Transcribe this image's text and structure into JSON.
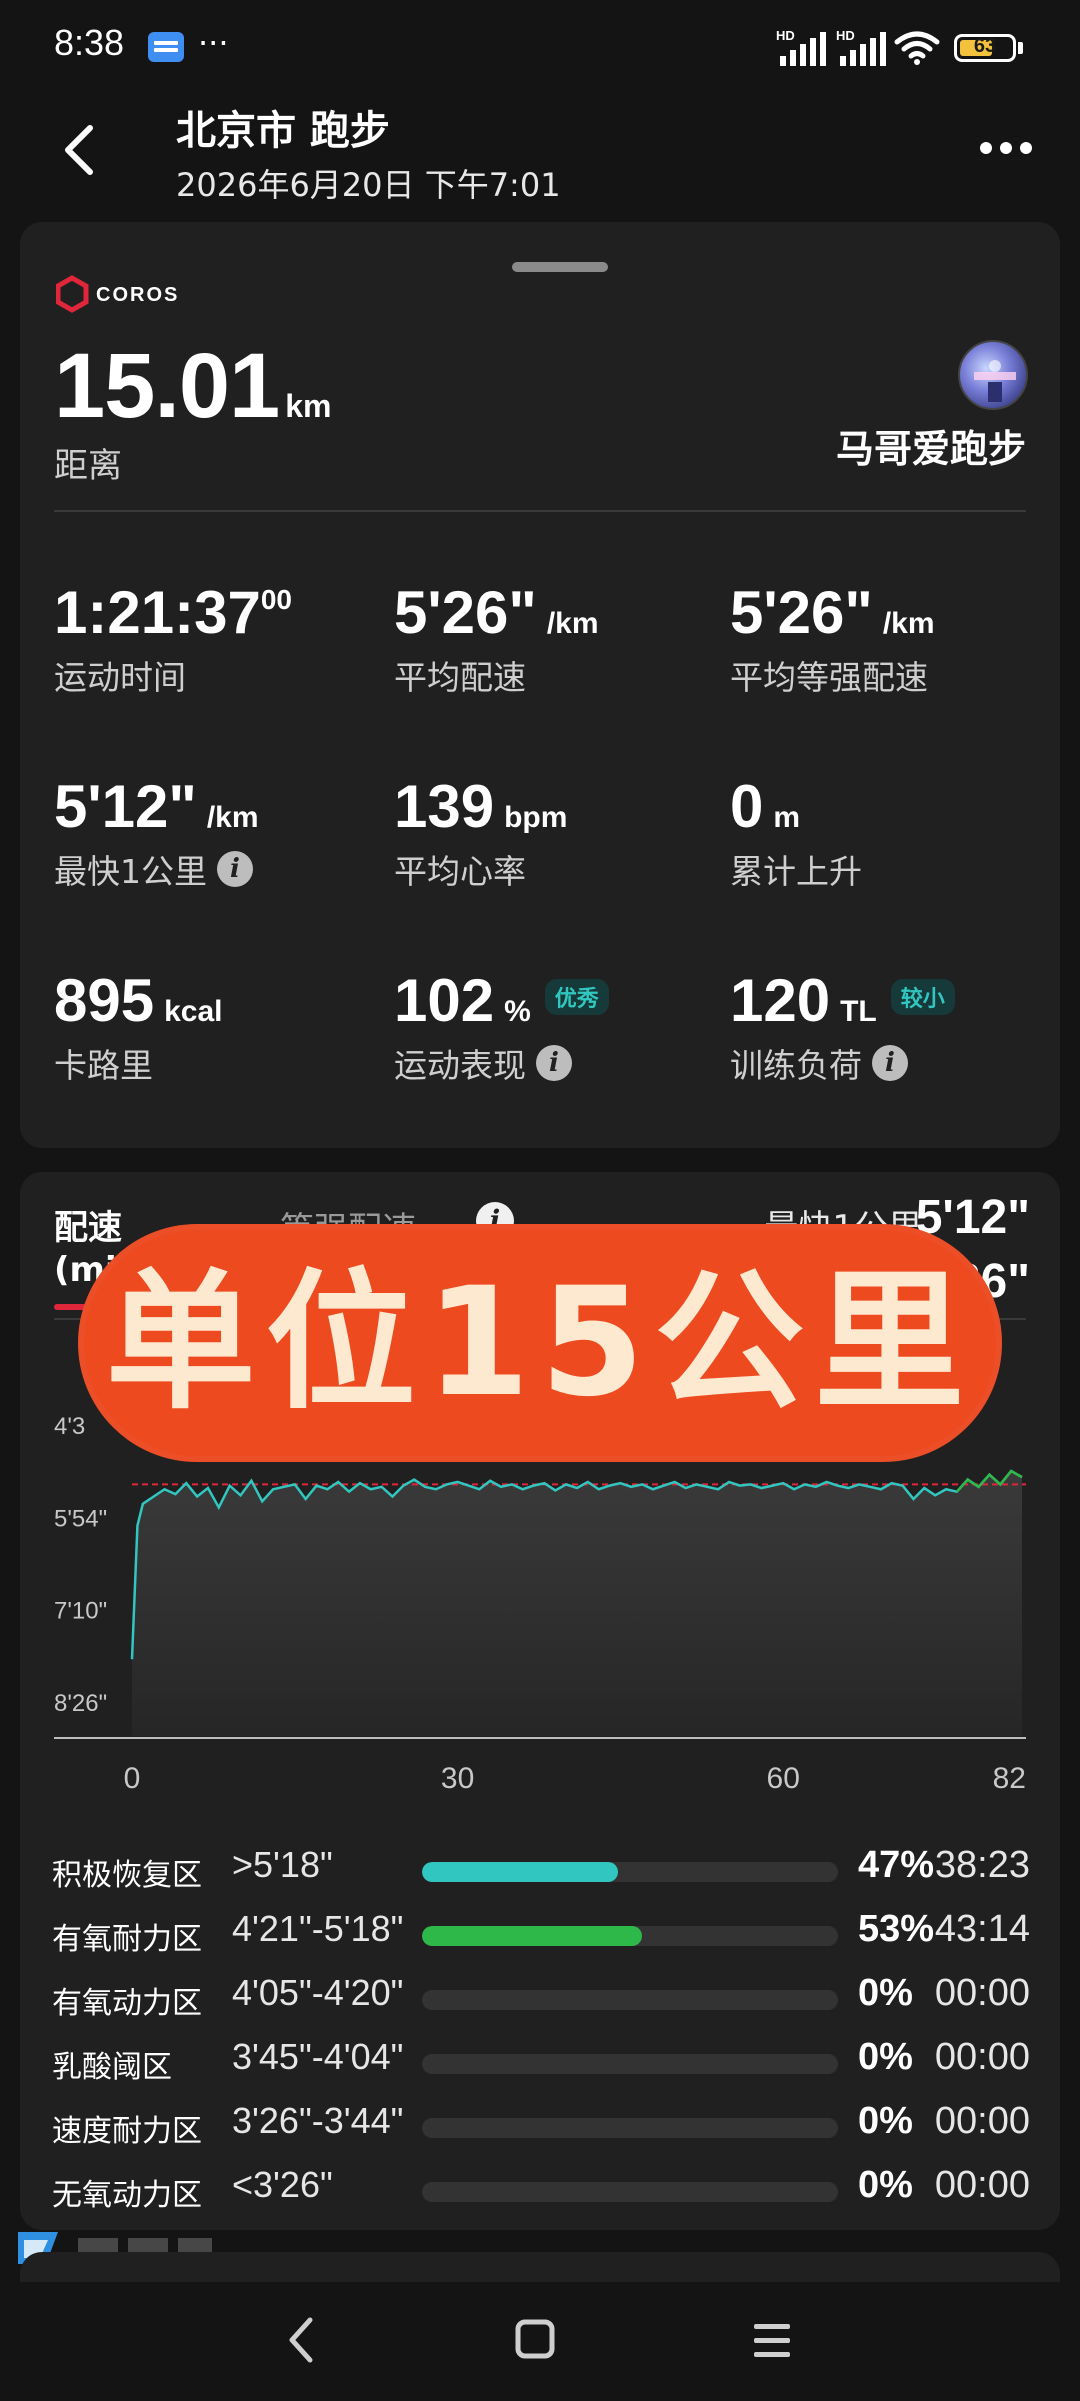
{
  "status_bar": {
    "time": "8:38",
    "notification_icon": "mail-app-icon",
    "more_indicator": "···",
    "signal_1_label": "HD",
    "signal_2_label": "HD",
    "battery_level": "63",
    "battery_percent": 63
  },
  "header": {
    "title": "北京市 跑步",
    "subtitle": "2026年6月20日 下午7:01",
    "back_icon": "chevron-left-icon",
    "more_icon": "more-horizontal-icon"
  },
  "summary": {
    "brand": "COROS",
    "distance_value": "15.01",
    "distance_unit": "km",
    "distance_label": "距离",
    "username": "马哥爱跑步",
    "stats": [
      {
        "value": "1:21:37",
        "sup": "00",
        "unit": "",
        "label": "运动时间"
      },
      {
        "value": "5'26\"",
        "unit": "/km",
        "label": "平均配速"
      },
      {
        "value": "5'26\"",
        "unit": "/km",
        "label": "平均等强配速"
      },
      {
        "value": "5'12\"",
        "unit": "/km",
        "label": "最快1公里"
      },
      {
        "value": "139",
        "unit": "bpm",
        "label": "平均心率"
      },
      {
        "value": "0",
        "unit": "m",
        "label": "累计上升"
      },
      {
        "value": "895",
        "unit": "kcal",
        "label": "卡路里"
      },
      {
        "value": "102",
        "unit": "%",
        "badge": "优秀",
        "label": "运动表现"
      },
      {
        "value": "120",
        "unit": "TL",
        "badge": "较小",
        "label": "训练负荷"
      }
    ]
  },
  "pace_card": {
    "tab_pace": "配速",
    "tab_pace_unit": "(mi",
    "tab_equiv": "等强配速",
    "fastest_label": "最快1公里",
    "fastest_value": "5'12\"",
    "avg_value_partial": "26\"",
    "overlay_text": "单位15公里",
    "chart_data": {
      "type": "line",
      "y_ticks": [
        "4'3",
        "5'54\"",
        "7'10\"",
        "8'26\""
      ],
      "y_tick_values": [
        278,
        354,
        430,
        506
      ],
      "x_ticks": [
        "0",
        "30",
        "60",
        "82"
      ],
      "x_tick_values": [
        0,
        30,
        60,
        82
      ],
      "x_range": [
        0,
        82
      ],
      "y_range_sec_per_km": [
        240,
        530
      ],
      "avg_pace_sec": 326,
      "series_color": "#31c7c0",
      "fast_segment_color": "#2fb84a",
      "avg_line_color": "#e0263a",
      "x": [
        0,
        0.5,
        1,
        2,
        3,
        4,
        5,
        6,
        7,
        8,
        9,
        10,
        11,
        12,
        13,
        14,
        15,
        16,
        17,
        18,
        19,
        20,
        21,
        22,
        23,
        24,
        25,
        26,
        27,
        28,
        29,
        30,
        31,
        32,
        33,
        34,
        35,
        36,
        37,
        38,
        39,
        40,
        41,
        42,
        43,
        44,
        45,
        46,
        47,
        48,
        49,
        50,
        51,
        52,
        53,
        54,
        55,
        56,
        57,
        58,
        59,
        60,
        61,
        62,
        63,
        64,
        65,
        66,
        67,
        68,
        69,
        70,
        71,
        72,
        73,
        74,
        75,
        76,
        77,
        78,
        79,
        80,
        81,
        82
      ],
      "y": [
        470,
        360,
        342,
        336,
        330,
        334,
        325,
        336,
        329,
        345,
        327,
        335,
        323,
        340,
        330,
        328,
        326,
        338,
        327,
        330,
        324,
        332,
        325,
        330,
        328,
        336,
        327,
        322,
        328,
        330,
        326,
        324,
        327,
        330,
        323,
        328,
        326,
        330,
        327,
        325,
        331,
        326,
        329,
        324,
        330,
        327,
        325,
        328,
        326,
        330,
        327,
        324,
        329,
        326,
        328,
        330,
        324,
        327,
        326,
        329,
        327,
        325,
        330,
        326,
        328,
        324,
        327,
        329,
        326,
        328,
        330,
        325,
        327,
        338,
        329,
        335,
        330,
        332,
        322,
        328,
        318,
        326,
        315,
        320
      ]
    },
    "zones": [
      {
        "name": "积极恢复区",
        "range": ">5'18\"",
        "percent": 47,
        "percent_label": "47%",
        "time": "38:23",
        "color": "#31c7c0"
      },
      {
        "name": "有氧耐力区",
        "range": "4'21\"-5'18\"",
        "percent": 53,
        "percent_label": "53%",
        "time": "43:14",
        "color": "#2fb84a"
      },
      {
        "name": "有氧动力区",
        "range": "4'05\"-4'20\"",
        "percent": 0,
        "percent_label": "0%",
        "time": "00:00",
        "color": "#2fb84a"
      },
      {
        "name": "乳酸阈区",
        "range": "3'45\"-4'04\"",
        "percent": 0,
        "percent_label": "0%",
        "time": "00:00",
        "color": "#f2c23d"
      },
      {
        "name": "速度耐力区",
        "range": "3'26\"-3'44\"",
        "percent": 0,
        "percent_label": "0%",
        "time": "00:00",
        "color": "#f28a2d"
      },
      {
        "name": "无氧动力区",
        "range": "<3'26\"",
        "percent": 0,
        "percent_label": "0%",
        "time": "00:00",
        "color": "#e0263a"
      }
    ]
  },
  "nav_bar": {
    "back_icon": "nav-back-icon",
    "home_icon": "nav-home-icon",
    "menu_icon": "nav-menu-icon"
  }
}
